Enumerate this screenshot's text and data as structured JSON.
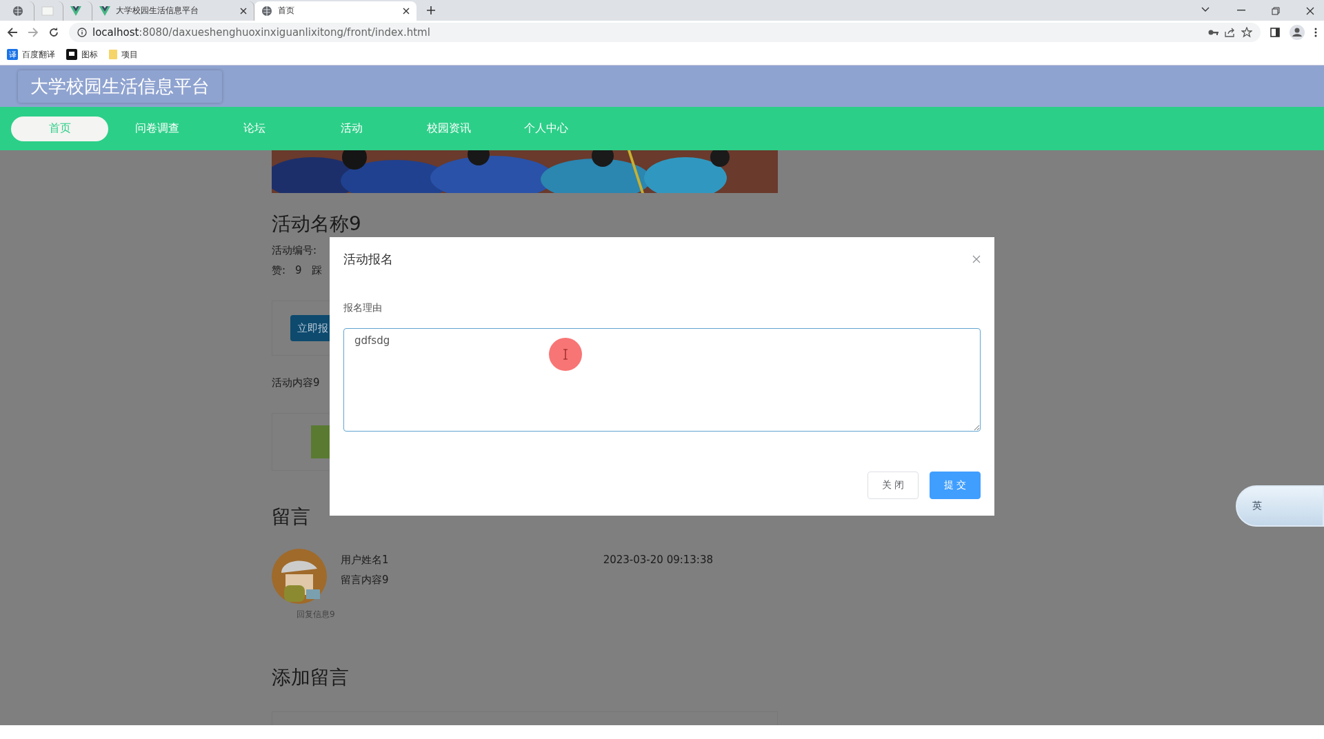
{
  "browser": {
    "tabs": [
      {
        "kind": "globe",
        "selected": false
      },
      {
        "kind": "page",
        "selected": false
      },
      {
        "kind": "vue",
        "selected": false
      },
      {
        "kind": "vue",
        "label": "大学校园生活信息平台",
        "selected": false
      },
      {
        "kind": "globe",
        "label": "首页",
        "selected": true
      }
    ],
    "url_host": "localhost",
    "url_rest": ":8080/daxueshenghuoxinxiguanlixitong/front/index.html",
    "bookmarks": [
      {
        "kind": "translate",
        "icon_text": "译",
        "label": "百度翻译"
      },
      {
        "kind": "flag",
        "label": "图标"
      },
      {
        "kind": "folder",
        "label": "项目"
      }
    ]
  },
  "site_title": "大学校园生活信息平台",
  "nav": [
    {
      "label": "首页",
      "selected": true
    },
    {
      "label": "问卷调查",
      "selected": false
    },
    {
      "label": "论坛",
      "selected": false
    },
    {
      "label": "活动",
      "selected": false
    },
    {
      "label": "校园资讯",
      "selected": false
    },
    {
      "label": "个人中心",
      "selected": false
    }
  ],
  "activity": {
    "name": "活动名称9",
    "number_label": "活动编号:",
    "likes_label": "赞:",
    "likes": "9",
    "dislikes_label": "踩",
    "signup_button": "立即报",
    "content": "活动内容9"
  },
  "comments": {
    "title": "留言",
    "items": [
      {
        "user": "用户姓名1",
        "content": "留言内容9",
        "time": "2023-03-20 09:13:38",
        "reply": "回复信息9"
      }
    ],
    "add_title": "添加留言"
  },
  "dialog": {
    "title": "活动报名",
    "field_label": "报名理由",
    "value": "gdfsdg",
    "buttons": [
      {
        "kind": "default",
        "label": "关 闭"
      },
      {
        "kind": "primary",
        "label": "提 交"
      }
    ]
  },
  "ime_widget": {
    "label": "英"
  }
}
